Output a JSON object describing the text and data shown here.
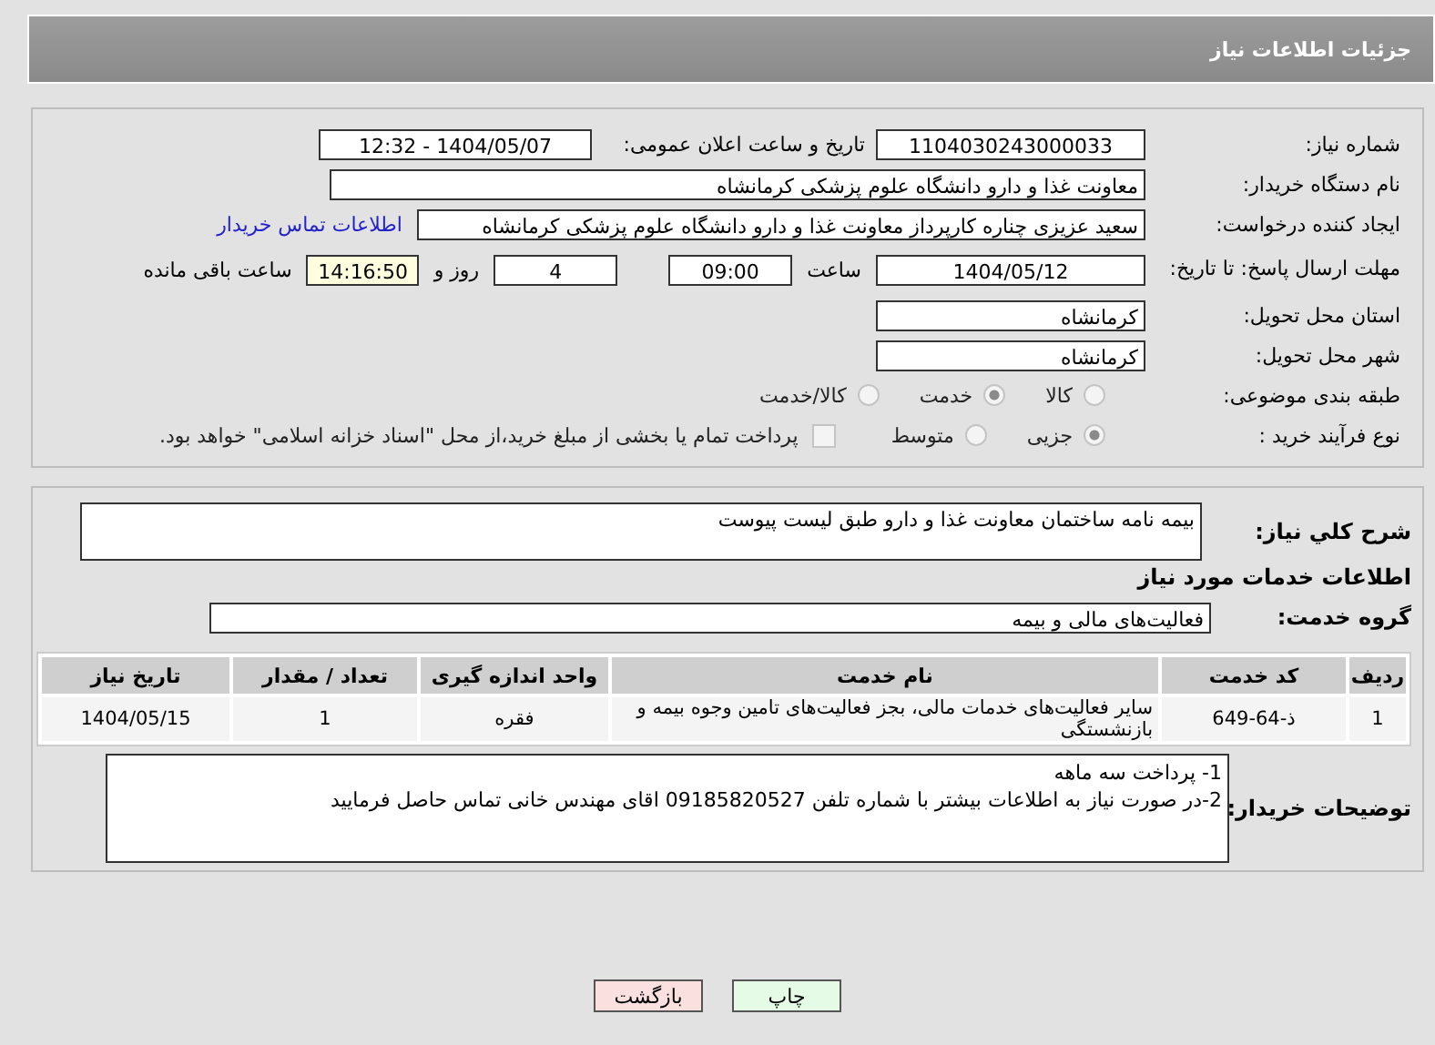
{
  "header": {
    "title": "جزئیات اطلاعات نیاز"
  },
  "need_number": {
    "label": "شماره نیاز:",
    "value": "1104030243000033"
  },
  "announce": {
    "label": "تاریخ و ساعت اعلان عمومی:",
    "value": "1404/05/07 - 12:32"
  },
  "buyer_org": {
    "label": "نام دستگاه خریدار:",
    "value": "معاونت غذا و دارو دانشگاه علوم پزشکی کرمانشاه"
  },
  "requester": {
    "label": "ایجاد کننده درخواست:",
    "value": "سعید عزیزی چناره کارپرداز معاونت غذا و دارو دانشگاه علوم پزشکی کرمانشاه",
    "link": "اطلاعات تماس خریدار"
  },
  "deadline": {
    "label": "مهلت ارسال پاسخ: تا تاریخ:",
    "date": "1404/05/12",
    "time_label": "ساعت",
    "time": "09:00",
    "days": "4",
    "days_label": "روز و",
    "remaining": "14:16:50",
    "remaining_label": "ساعت باقی مانده"
  },
  "province": {
    "label": "استان محل تحویل:",
    "value": "کرمانشاه"
  },
  "city": {
    "label": "شهر محل تحویل:",
    "value": "کرمانشاه"
  },
  "category": {
    "label": "طبقه بندی موضوعی:",
    "options": [
      {
        "label": "کالا",
        "selected": false
      },
      {
        "label": "خدمت",
        "selected": true
      },
      {
        "label": "کالا/خدمت",
        "selected": false
      }
    ]
  },
  "process": {
    "label": "نوع فرآیند خرید :",
    "options": [
      {
        "label": "جزیی",
        "selected": true
      },
      {
        "label": "متوسط",
        "selected": false
      }
    ],
    "payment": {
      "label": "پرداخت تمام یا بخشی از مبلغ خرید،از محل \"اسناد خزانه اسلامی\" خواهد بود.",
      "checked": false
    }
  },
  "summary": {
    "label": "شرح کلي نياز:",
    "value": "بیمه نامه ساختمان معاونت  غذا و دارو طبق لیست پیوست"
  },
  "services_heading": "اطلاعات خدمات مورد نیاز",
  "service_group": {
    "label": "گروه خدمت:",
    "value": "فعالیت‌های مالی و بیمه"
  },
  "table": {
    "columns": [
      "ردیف",
      "کد خدمت",
      "نام خدمت",
      "واحد اندازه گیری",
      "تعداد / مقدار",
      "تاریخ نیاز"
    ],
    "rows": [
      [
        "1",
        "ذ-64-649",
        "سایر فعالیت‌های خدمات مالی، بجز فعالیت‌های تامین وجوه بیمه و بازنشستگی",
        "فقره",
        "1",
        "1404/05/15"
      ]
    ]
  },
  "buyer_notes": {
    "label": "توضیحات خریدار:",
    "lines": [
      "1- پرداخت سه ماهه",
      "2-در صورت نیاز به اطلاعات بیشتر با شماره تلفن 09185820527 اقای مهندس خانی تماس حاصل فرمایید"
    ]
  },
  "buttons": [
    {
      "label": "چاپ",
      "kind": "print"
    },
    {
      "label": "بازگشت",
      "kind": "back"
    }
  ]
}
